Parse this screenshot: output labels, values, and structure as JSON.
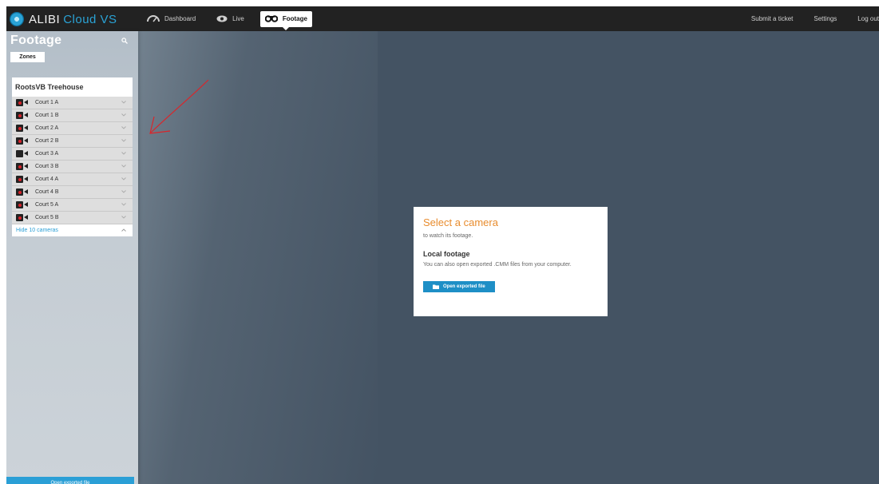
{
  "app": {
    "logo_main": "ALIBI",
    "logo_sub": "Cloud VS"
  },
  "nav": {
    "dashboard": "Dashboard",
    "live": "Live",
    "footage": "Footage"
  },
  "top_right": {
    "submit_ticket": "Submit a ticket",
    "settings": "Settings",
    "logout": "Log out"
  },
  "sidebar": {
    "title": "Footage",
    "zones_tab": "Zones",
    "site_name": "RootsVB Treehouse",
    "cameras": [
      {
        "label": "Court 1 A",
        "recording": true
      },
      {
        "label": "Court 1 B",
        "recording": true
      },
      {
        "label": "Court 2 A",
        "recording": true
      },
      {
        "label": "Court 2 B",
        "recording": true
      },
      {
        "label": "Court 3 A",
        "recording": false
      },
      {
        "label": "Court 3 B",
        "recording": true
      },
      {
        "label": "Court 4 A",
        "recording": true
      },
      {
        "label": "Court 4 B",
        "recording": true
      },
      {
        "label": "Court 5 A",
        "recording": true
      },
      {
        "label": "Court 5 B",
        "recording": true
      }
    ],
    "hide_label": "Hide 10 cameras",
    "bottom_button": "Open exported file"
  },
  "dialog": {
    "title": "Select a camera",
    "subtitle": "to watch its footage.",
    "local_heading": "Local footage",
    "local_text": "You can also open exported .CMM files from your computer.",
    "button": "Open exported file"
  },
  "colors": {
    "accent": "#2a9fd6",
    "title_orange": "#e88c2e",
    "record_red": "#d8232a",
    "annotation_red": "#d9262b"
  }
}
